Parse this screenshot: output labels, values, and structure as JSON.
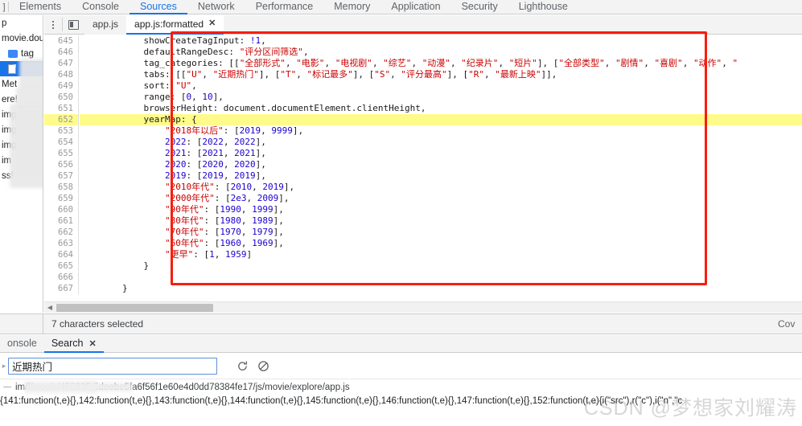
{
  "devtools": {
    "main_tabs": [
      {
        "label": "Elements",
        "active": false
      },
      {
        "label": "Console",
        "active": false
      },
      {
        "label": "Sources",
        "active": true
      },
      {
        "label": "Network",
        "active": false
      },
      {
        "label": "Performance",
        "active": false
      },
      {
        "label": "Memory",
        "active": false
      },
      {
        "label": "Application",
        "active": false
      },
      {
        "label": "Security",
        "active": false
      },
      {
        "label": "Lighthouse",
        "active": false
      }
    ],
    "left_edge_glyph": "]"
  },
  "sidebar": {
    "items": [
      {
        "label": "p",
        "type": "text",
        "indent": 0,
        "selected": false
      },
      {
        "label": "movie.dou",
        "type": "text",
        "indent": 0,
        "selected": false
      },
      {
        "label": "tag",
        "type": "folder",
        "indent": 1,
        "selected": false
      },
      {
        "label": "",
        "type": "file",
        "indent": 1,
        "selected": true
      },
      {
        "label": "Met",
        "type": "text",
        "indent": 0,
        "selected": false
      },
      {
        "label": "ere!",
        "type": "text",
        "indent": 0,
        "selected": false
      },
      {
        "label": "img",
        "type": "text",
        "indent": 0,
        "selected": false
      },
      {
        "label": "img",
        "type": "text",
        "indent": 0,
        "selected": false
      },
      {
        "label": "img",
        "type": "text",
        "indent": 0,
        "selected": false
      },
      {
        "label": "im",
        "type": "text",
        "indent": 0,
        "selected": false
      },
      {
        "label": "ss!",
        "type": "text",
        "indent": 0,
        "selected": false
      }
    ]
  },
  "editor": {
    "tabs": [
      {
        "label": "app.js",
        "active": false,
        "closable": false
      },
      {
        "label": "app.js:formatted",
        "active": true,
        "closable": true,
        "close_glyph": "✕"
      }
    ],
    "panel_toggle_name": "show-navigator",
    "first_line_number": 645,
    "highlighted_line_number": 653,
    "lines": [
      {
        "n": 645,
        "tokens": [
          {
            "t": "            showCreateTagInput: ",
            "c": "plain"
          },
          {
            "t": "!1",
            "c": "num"
          },
          {
            "t": ",",
            "c": "plain"
          }
        ]
      },
      {
        "n": 646,
        "tokens": [
          {
            "t": "            defaultRangeDesc: ",
            "c": "plain"
          },
          {
            "t": "\"评分区间筛选\"",
            "c": "str"
          },
          {
            "t": ",",
            "c": "plain"
          }
        ]
      },
      {
        "n": 647,
        "tokens": [
          {
            "t": "            tag_categories: [[",
            "c": "plain"
          },
          {
            "t": "\"全部形式\"",
            "c": "str"
          },
          {
            "t": ", ",
            "c": "plain"
          },
          {
            "t": "\"电影\"",
            "c": "str"
          },
          {
            "t": ", ",
            "c": "plain"
          },
          {
            "t": "\"电视剧\"",
            "c": "str"
          },
          {
            "t": ", ",
            "c": "plain"
          },
          {
            "t": "\"综艺\"",
            "c": "str"
          },
          {
            "t": ", ",
            "c": "plain"
          },
          {
            "t": "\"动漫\"",
            "c": "str"
          },
          {
            "t": ", ",
            "c": "plain"
          },
          {
            "t": "\"纪录片\"",
            "c": "str"
          },
          {
            "t": ", ",
            "c": "plain"
          },
          {
            "t": "\"短片\"",
            "c": "str"
          },
          {
            "t": "], [",
            "c": "plain"
          },
          {
            "t": "\"全部类型\"",
            "c": "str"
          },
          {
            "t": ", ",
            "c": "plain"
          },
          {
            "t": "\"剧情\"",
            "c": "str"
          },
          {
            "t": ", ",
            "c": "plain"
          },
          {
            "t": "\"喜剧\"",
            "c": "str"
          },
          {
            "t": ", ",
            "c": "plain"
          },
          {
            "t": "\"动作\"",
            "c": "str"
          },
          {
            "t": ", ",
            "c": "plain"
          },
          {
            "t": "\"",
            "c": "str"
          }
        ]
      },
      {
        "n": 648,
        "tokens": [
          {
            "t": "            tabs: [[",
            "c": "plain"
          },
          {
            "t": "\"U\"",
            "c": "str"
          },
          {
            "t": ", ",
            "c": "plain"
          },
          {
            "t": "\"近期热门\"",
            "c": "str"
          },
          {
            "t": "], [",
            "c": "plain"
          },
          {
            "t": "\"T\"",
            "c": "str"
          },
          {
            "t": ", ",
            "c": "plain"
          },
          {
            "t": "\"标记最多\"",
            "c": "str"
          },
          {
            "t": "], [",
            "c": "plain"
          },
          {
            "t": "\"S\"",
            "c": "str"
          },
          {
            "t": ", ",
            "c": "plain"
          },
          {
            "t": "\"评分最高\"",
            "c": "str"
          },
          {
            "t": "], [",
            "c": "plain"
          },
          {
            "t": "\"R\"",
            "c": "str"
          },
          {
            "t": ", ",
            "c": "plain"
          },
          {
            "t": "\"最新上映\"",
            "c": "str"
          },
          {
            "t": "]],",
            "c": "plain"
          }
        ]
      },
      {
        "n": 649,
        "tokens": [
          {
            "t": "            sort: ",
            "c": "plain"
          },
          {
            "t": "\"U\"",
            "c": "str"
          },
          {
            "t": ",",
            "c": "plain"
          }
        ]
      },
      {
        "n": 650,
        "tokens": [
          {
            "t": "            range: [",
            "c": "plain"
          },
          {
            "t": "0",
            "c": "num"
          },
          {
            "t": ", ",
            "c": "plain"
          },
          {
            "t": "10",
            "c": "num"
          },
          {
            "t": "],",
            "c": "plain"
          }
        ]
      },
      {
        "n": 651,
        "tokens": [
          {
            "t": "            browserHeight: document.documentElement.clientHeight,",
            "c": "plain"
          }
        ]
      },
      {
        "n": 652,
        "tokens": [
          {
            "t": "            yearMap: {",
            "c": "plain"
          }
        ],
        "highlight": true
      },
      {
        "n": 653,
        "tokens": [
          {
            "t": "                ",
            "c": "plain"
          },
          {
            "t": "\"2018年以后\"",
            "c": "str"
          },
          {
            "t": ": [",
            "c": "plain"
          },
          {
            "t": "2019",
            "c": "num"
          },
          {
            "t": ", ",
            "c": "plain"
          },
          {
            "t": "9999",
            "c": "num"
          },
          {
            "t": "],",
            "c": "plain"
          }
        ]
      },
      {
        "n": 654,
        "tokens": [
          {
            "t": "                ",
            "c": "plain"
          },
          {
            "t": "2022",
            "c": "num"
          },
          {
            "t": ": [",
            "c": "plain"
          },
          {
            "t": "2022",
            "c": "num"
          },
          {
            "t": ", ",
            "c": "plain"
          },
          {
            "t": "2022",
            "c": "num"
          },
          {
            "t": "],",
            "c": "plain"
          }
        ]
      },
      {
        "n": 655,
        "tokens": [
          {
            "t": "                ",
            "c": "plain"
          },
          {
            "t": "2021",
            "c": "num"
          },
          {
            "t": ": [",
            "c": "plain"
          },
          {
            "t": "2021",
            "c": "num"
          },
          {
            "t": ", ",
            "c": "plain"
          },
          {
            "t": "2021",
            "c": "num"
          },
          {
            "t": "],",
            "c": "plain"
          }
        ]
      },
      {
        "n": 656,
        "tokens": [
          {
            "t": "                ",
            "c": "plain"
          },
          {
            "t": "2020",
            "c": "num"
          },
          {
            "t": ": [",
            "c": "plain"
          },
          {
            "t": "2020",
            "c": "num"
          },
          {
            "t": ", ",
            "c": "plain"
          },
          {
            "t": "2020",
            "c": "num"
          },
          {
            "t": "],",
            "c": "plain"
          }
        ]
      },
      {
        "n": 657,
        "tokens": [
          {
            "t": "                ",
            "c": "plain"
          },
          {
            "t": "2019",
            "c": "num"
          },
          {
            "t": ": [",
            "c": "plain"
          },
          {
            "t": "2019",
            "c": "num"
          },
          {
            "t": ", ",
            "c": "plain"
          },
          {
            "t": "2019",
            "c": "num"
          },
          {
            "t": "],",
            "c": "plain"
          }
        ]
      },
      {
        "n": 658,
        "tokens": [
          {
            "t": "                ",
            "c": "plain"
          },
          {
            "t": "\"2010年代\"",
            "c": "str"
          },
          {
            "t": ": [",
            "c": "plain"
          },
          {
            "t": "2010",
            "c": "num"
          },
          {
            "t": ", ",
            "c": "plain"
          },
          {
            "t": "2019",
            "c": "num"
          },
          {
            "t": "],",
            "c": "plain"
          }
        ]
      },
      {
        "n": 659,
        "tokens": [
          {
            "t": "                ",
            "c": "plain"
          },
          {
            "t": "\"2000年代\"",
            "c": "str"
          },
          {
            "t": ": [",
            "c": "plain"
          },
          {
            "t": "2e3",
            "c": "num"
          },
          {
            "t": ", ",
            "c": "plain"
          },
          {
            "t": "2009",
            "c": "num"
          },
          {
            "t": "],",
            "c": "plain"
          }
        ]
      },
      {
        "n": 660,
        "tokens": [
          {
            "t": "                ",
            "c": "plain"
          },
          {
            "t": "\"90年代\"",
            "c": "str"
          },
          {
            "t": ": [",
            "c": "plain"
          },
          {
            "t": "1990",
            "c": "num"
          },
          {
            "t": ", ",
            "c": "plain"
          },
          {
            "t": "1999",
            "c": "num"
          },
          {
            "t": "],",
            "c": "plain"
          }
        ]
      },
      {
        "n": 661,
        "tokens": [
          {
            "t": "                ",
            "c": "plain"
          },
          {
            "t": "\"80年代\"",
            "c": "str"
          },
          {
            "t": ": [",
            "c": "plain"
          },
          {
            "t": "1980",
            "c": "num"
          },
          {
            "t": ", ",
            "c": "plain"
          },
          {
            "t": "1989",
            "c": "num"
          },
          {
            "t": "],",
            "c": "plain"
          }
        ]
      },
      {
        "n": 662,
        "tokens": [
          {
            "t": "                ",
            "c": "plain"
          },
          {
            "t": "\"70年代\"",
            "c": "str"
          },
          {
            "t": ": [",
            "c": "plain"
          },
          {
            "t": "1970",
            "c": "num"
          },
          {
            "t": ", ",
            "c": "plain"
          },
          {
            "t": "1979",
            "c": "num"
          },
          {
            "t": "],",
            "c": "plain"
          }
        ]
      },
      {
        "n": 663,
        "tokens": [
          {
            "t": "                ",
            "c": "plain"
          },
          {
            "t": "\"60年代\"",
            "c": "str"
          },
          {
            "t": ": [",
            "c": "plain"
          },
          {
            "t": "1960",
            "c": "num"
          },
          {
            "t": ", ",
            "c": "plain"
          },
          {
            "t": "1969",
            "c": "num"
          },
          {
            "t": "],",
            "c": "plain"
          }
        ]
      },
      {
        "n": 664,
        "tokens": [
          {
            "t": "                ",
            "c": "plain"
          },
          {
            "t": "\"更早\"",
            "c": "str"
          },
          {
            "t": ": [",
            "c": "plain"
          },
          {
            "t": "1",
            "c": "num"
          },
          {
            "t": ", ",
            "c": "plain"
          },
          {
            "t": "1959",
            "c": "num"
          },
          {
            "t": "]",
            "c": "plain"
          }
        ]
      },
      {
        "n": 665,
        "tokens": [
          {
            "t": "            }",
            "c": "plain"
          }
        ]
      },
      {
        "n": 666,
        "tokens": [
          {
            "t": "",
            "c": "plain"
          }
        ]
      },
      {
        "n": 667,
        "tokens": [
          {
            "t": "        }",
            "c": "plain"
          }
        ]
      },
      {
        "n": 668,
        "tokens": [
          {
            "t": "        },",
            "c": "plain"
          }
        ]
      },
      {
        "n": 669,
        "tokens": [
          {
            "t": "",
            "c": "plain"
          }
        ]
      }
    ]
  },
  "status": {
    "selection_text": "7 characters selected",
    "right_label": "Cov"
  },
  "drawer": {
    "tabs": [
      {
        "label": "onsole",
        "active": false,
        "closable": false
      },
      {
        "label": "Search",
        "active": true,
        "closable": true,
        "close_glyph": "✕"
      }
    ],
    "search": {
      "value": "近期热门",
      "placeholder": "",
      "refresh_icon": "refresh-icon",
      "clear_icon": "clear-icon",
      "caret_glyph": "▸"
    },
    "results": [
      {
        "twisty": "—",
        "file": "/f/movie/45593fb5deebe5fa6f56f1e60e4d0dd78384fe17/js/movie/explore/app.js",
        "prefix": "im",
        "match_line": "{141:function(t,e){},142:function(t,e){},143:function(t,e){},144:function(t,e){},145:function(t,e){},146:function(t,e){},147:function(t,e){},152:function(t,e){i(\"src\"),r(\"c\"),i(\"n\",\"c"
      }
    ]
  },
  "watermark": {
    "text": "CSDN @梦想家刘耀涛"
  },
  "colors": {
    "accent": "#1a73e8",
    "annotation_red": "#f81d0c",
    "highlight_yellow": "#fffb8a",
    "string_red": "#c80000",
    "number_blue": "#1c00cf",
    "chrome_bg": "#f3f3f3"
  }
}
